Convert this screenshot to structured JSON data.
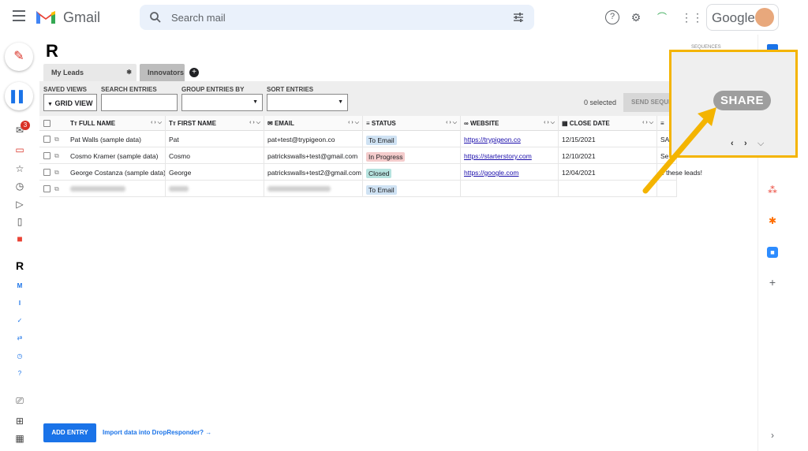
{
  "gmail": {
    "title": "Gmail",
    "search_placeholder": "Search mail",
    "account_brand": "Google",
    "inbox_badge": "3"
  },
  "app": {
    "tabs": [
      {
        "label": "My Leads"
      },
      {
        "label": "Innovators"
      }
    ],
    "sequences_label": "SEQUENCES",
    "controls": {
      "saved_views_label": "SAVED VIEWS",
      "saved_views_value": "GRID VIEW",
      "search_entries_label": "SEARCH ENTRIES",
      "group_by_label": "GROUP ENTRIES BY",
      "sort_label": "SORT ENTRIES",
      "selected_count": "0 selected",
      "send_button": "SEND SEQUENCE"
    },
    "columns": [
      {
        "icon": "Tт",
        "label": "FULL NAME"
      },
      {
        "icon": "Tт",
        "label": "FIRST NAME"
      },
      {
        "icon": "✉",
        "label": "EMAIL"
      },
      {
        "icon": "≡",
        "label": "STATUS"
      },
      {
        "icon": "∞",
        "label": "WEBSITE"
      },
      {
        "icon": "▦",
        "label": "CLOSE DATE"
      },
      {
        "icon": "≡",
        "label": ""
      }
    ],
    "rows": [
      {
        "full_name": "Pat Walls (sample data)",
        "first_name": "Pat",
        "email": "pat+test@trypigeon.co",
        "status": "To Email",
        "website": "https://trypigeon.co",
        "close_date": "12/15/2021",
        "notes": "SA"
      },
      {
        "full_name": "Cosmo Kramer (sample data)",
        "first_name": "Cosmo",
        "email": "patrickswalls+test@gmail.com",
        "status": "In Progress",
        "website": "https://starterstory.com",
        "close_date": "12/10/2021",
        "notes": "Se"
      },
      {
        "full_name": "George Costanza (sample data)",
        "first_name": "George",
        "email": "patrickswalls+test2@gmail.com",
        "status": "Closed",
        "website": "https://google.com",
        "close_date": "12/04/2021",
        "notes": "e these leads!"
      },
      {
        "full_name": "",
        "first_name": "",
        "email": "",
        "status": "To Email",
        "website": "",
        "close_date": "",
        "notes": ""
      }
    ],
    "status_colors": {
      "To Email": "#cfe2f3",
      "In Progress": "#f4cccc",
      "Closed": "#b6e3df"
    },
    "add_entry_button": "ADD ENTRY",
    "import_link": "Import data into DropResponder? →"
  },
  "callout": {
    "share_button": "SHARE",
    "highlight_color": "#f4b400"
  }
}
